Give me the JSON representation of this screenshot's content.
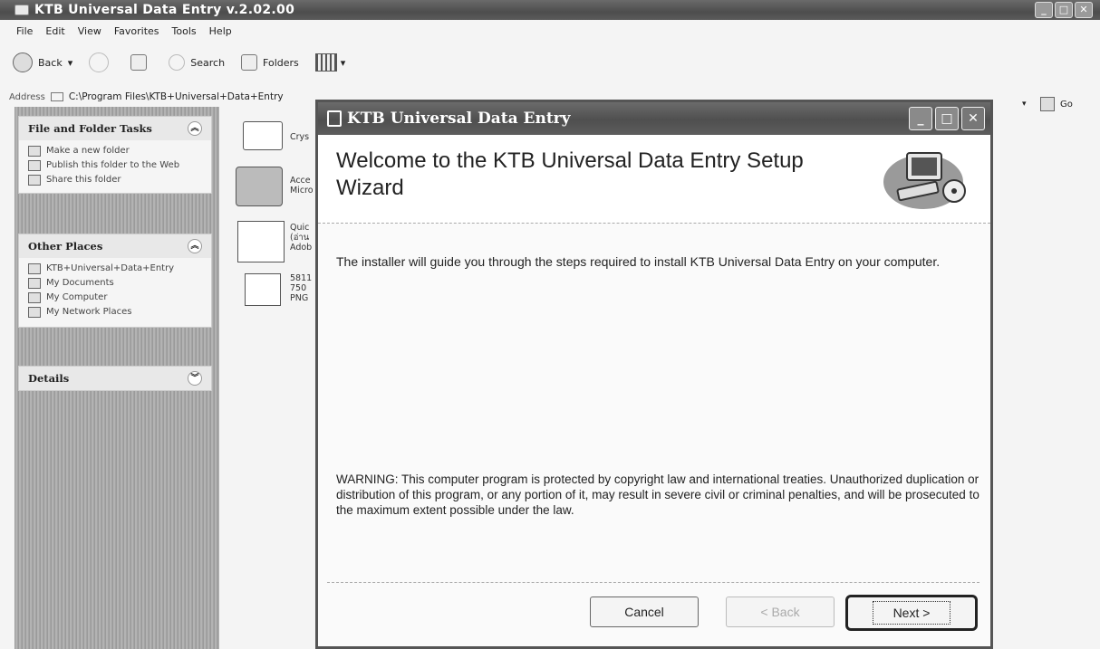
{
  "explorer": {
    "title": "KTB Universal Data Entry v.2.02.00",
    "menu": [
      "File",
      "Edit",
      "View",
      "Favorites",
      "Tools",
      "Help"
    ],
    "toolbar": {
      "back": "Back",
      "search": "Search",
      "folders": "Folders"
    },
    "address_label": "Address",
    "address_path": "C:\\Program Files\\KTB+Universal+Data+Entry",
    "go_label": "Go"
  },
  "task_pane": {
    "file_folder_tasks": {
      "title": "File and Folder Tasks",
      "items": [
        "Make a new folder",
        "Publish this folder to the Web",
        "Share this folder"
      ]
    },
    "other_places": {
      "title": "Other Places",
      "items": [
        "KTB+Universal+Data+Entry",
        "My Documents",
        "My Computer",
        "My Network Places"
      ]
    },
    "details": {
      "title": "Details"
    }
  },
  "files": [
    {
      "name": "Crys"
    },
    {
      "name": "Acce",
      "sub": "Micro"
    },
    {
      "name": "Quic",
      "sub": "(อ่าน",
      "sub2": "Adob"
    },
    {
      "name": "5811",
      "sub": "750",
      "sub2": "PNG"
    }
  ],
  "dialog": {
    "title": "KTB Universal Data Entry",
    "heading": "Welcome to the KTB Universal Data Entry Setup Wizard",
    "intro": "The installer will guide you through the steps required to install KTB Universal Data Entry on your computer.",
    "warning": "WARNING: This computer program is protected by copyright law and international treaties. Unauthorized duplication or distribution of this program, or any portion of it, may result in severe civil or criminal penalties, and will be prosecuted to the maximum extent possible under the law.",
    "buttons": {
      "cancel": "Cancel",
      "back": "< Back",
      "next": "Next >"
    }
  }
}
